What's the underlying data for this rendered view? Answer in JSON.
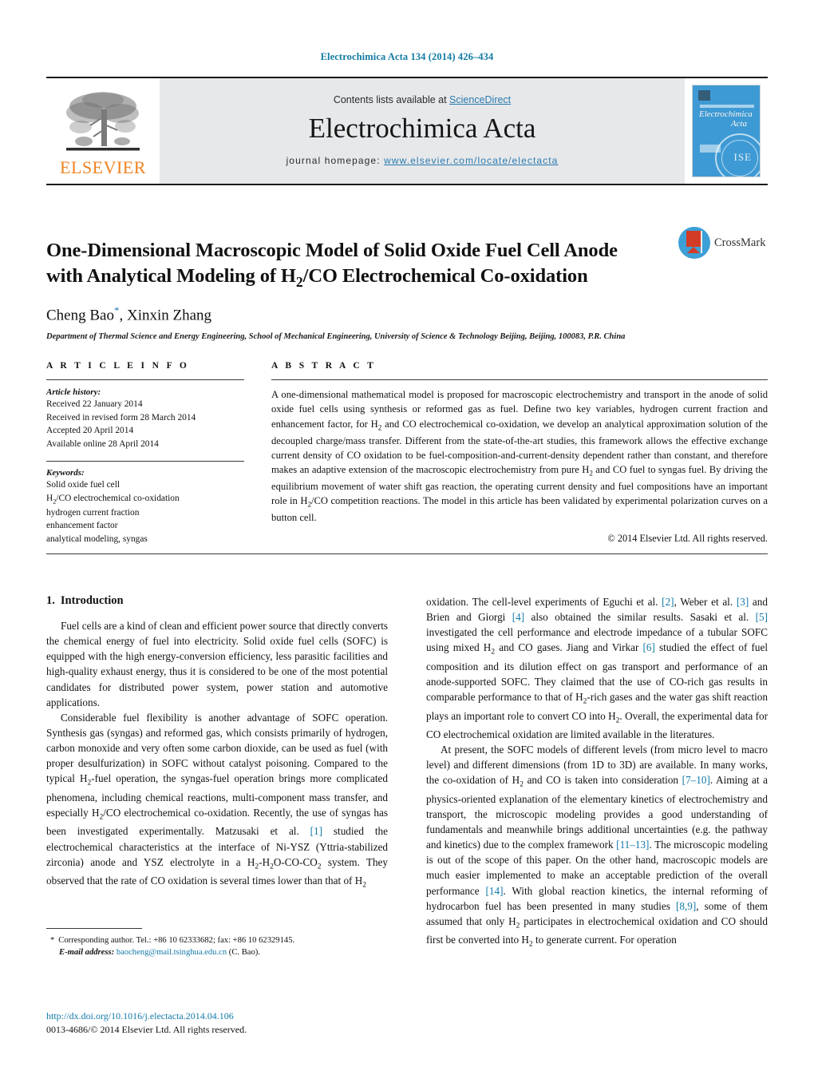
{
  "running_head": "Electrochimica Acta 134 (2014) 426–434",
  "masthead": {
    "publisher_name": "ELSEVIER",
    "contents_prefix": "Contents lists available at ",
    "contents_link": "ScienceDirect",
    "journal_title": "Electrochimica Acta",
    "homepage_prefix": "journal homepage: ",
    "homepage_url": "www.elsevier.com/locate/electacta",
    "cover": {
      "title_line1": "Electrochimica",
      "title_line2": "Acta",
      "seal_text": "ISE"
    }
  },
  "article": {
    "title_line1": "One-Dimensional Macroscopic Model of Solid Oxide Fuel Cell Anode",
    "title_line2_pre": "with Analytical Modeling of H",
    "title_line2_sub": "2",
    "title_line2_post": "/CO Electrochemical Co-oxidation",
    "crossmark_label": "CrossMark",
    "authors_pre": "Cheng Bao",
    "authors_star": "*",
    "authors_post": ", Xinxin Zhang",
    "affiliation": "Department of Thermal Science and Energy Engineering, School of Mechanical Engineering, University of Science & Technology Beijing, Beijing, 100083, P.R. China"
  },
  "article_info": {
    "heading": "A R T I C L E   I N F O",
    "history_label": "Article history:",
    "history": [
      "Received 22 January 2014",
      "Received in revised form 28 March 2014",
      "Accepted 20 April 2014",
      "Available online 28 April 2014"
    ],
    "keywords_label": "Keywords:",
    "keywords": [
      "Solid oxide fuel cell",
      "H2/CO electrochemical co-oxidation",
      "hydrogen current fraction",
      "enhancement factor",
      "analytical modeling, syngas"
    ]
  },
  "abstract": {
    "heading": "A B S T R A C T",
    "text": "A one-dimensional mathematical model is proposed for macroscopic electrochemistry and transport in the anode of solid oxide fuel cells using synthesis or reformed gas as fuel. Define two key variables, hydrogen current fraction and enhancement factor, for H2 and CO electrochemical co-oxidation, we develop an analytical approximation solution of the decoupled charge/mass transfer. Different from the state-of-the-art studies, this framework allows the effective exchange current density of CO oxidation to be fuel-composition-and-current-density dependent rather than constant, and therefore makes an adaptive extension of the macroscopic electrochemistry from pure H2 and CO fuel to syngas fuel. By driving the equilibrium movement of water shift gas reaction, the operating current density and fuel compositions have an important role in H2/CO competition reactions. The model in this article has been validated by experimental polarization curves on a button cell.",
    "copyright": "© 2014 Elsevier Ltd. All rights reserved."
  },
  "body": {
    "section_number": "1.",
    "section_title": "Introduction",
    "left_paragraph_1": "Fuel cells are a kind of clean and efficient power source that directly converts the chemical energy of fuel into electricity. Solid oxide fuel cells (SOFC) is equipped with the high energy-conversion efficiency, less parasitic facilities and high-quality exhaust energy, thus it is considered to be one of the most potential candidates for distributed power system, power station and automotive applications.",
    "left_paragraph_2": "Considerable fuel flexibility is another advantage of SOFC operation. Synthesis gas (syngas) and reformed gas, which consists primarily of hydrogen, carbon monoxide and very often some carbon dioxide, can be used as fuel (with proper desulfurization) in SOFC without catalyst poisoning. Compared to the typical H2-fuel operation, the syngas-fuel operation brings more complicated phenomena, including chemical reactions, multi-component mass transfer, and especially H2/CO electrochemical co-oxidation. Recently, the use of syngas has been investigated experimentally. Matzusaki et al. [1] studied the electrochemical characteristics at the interface of Ni-YSZ (Yttria-stabilized zirconia) anode and YSZ electrolyte in a H2-H2O-CO-CO2 system. They observed that the rate of CO oxidation is several times lower than that of H2",
    "right_paragraph_1": "oxidation. The cell-level experiments of Eguchi et al. [2], Weber et al. [3] and Brien and Giorgi [4] also obtained the similar results. Sasaki et al. [5] investigated the cell performance and electrode impedance of a tubular SOFC using mixed H2 and CO gases. Jiang and Virkar [6] studied the effect of fuel composition and its dilution effect on gas transport and performance of an anode-supported SOFC. They claimed that the use of CO-rich gas results in comparable performance to that of H2-rich gases and the water gas shift reaction plays an important role to convert CO into H2. Overall, the experimental data for CO electrochemical oxidation are limited available in the literatures.",
    "right_paragraph_2": "At present, the SOFC models of different levels (from micro level to macro level) and different dimensions (from 1D to 3D) are available. In many works, the co-oxidation of H2 and CO is taken into consideration [7–10]. Aiming at a physics-oriented explanation of the elementary kinetics of electrochemistry and transport, the microscopic modeling provides a good understanding of fundamentals and meanwhile brings additional uncertainties (e.g. the pathway and kinetics) due to the complex framework [11–13]. The microscopic modeling is out of the scope of this paper. On the other hand, macroscopic models are much easier implemented to make an acceptable prediction of the overall performance [14]. With global reaction kinetics, the internal reforming of hydrocarbon fuel has been presented in many studies [8,9], some of them assumed that only H2 participates in electrochemical oxidation and CO should first be converted into H2 to generate current. For operation"
  },
  "footnote": {
    "star": "*",
    "corresponding": "Corresponding author. Tel.: +86 10 62333682; fax: +86 10 62329145.",
    "email_label": "E-mail address:",
    "email": "baocheng@mail.tsinghua.edu.cn",
    "email_suffix": "(C. Bao)."
  },
  "footer": {
    "doi": "http://dx.doi.org/10.1016/j.electacta.2014.04.106",
    "issn_line": "0013-4686/© 2014 Elsevier Ltd. All rights reserved."
  },
  "colors": {
    "link_blue": "#1279a8",
    "elsevier_orange": "#f08221",
    "band_gray": "#e7e8ea",
    "cover_blue": "#3e9ad4",
    "crossmark_blue": "#3c9fd6",
    "crossmark_red": "#d23c26"
  }
}
